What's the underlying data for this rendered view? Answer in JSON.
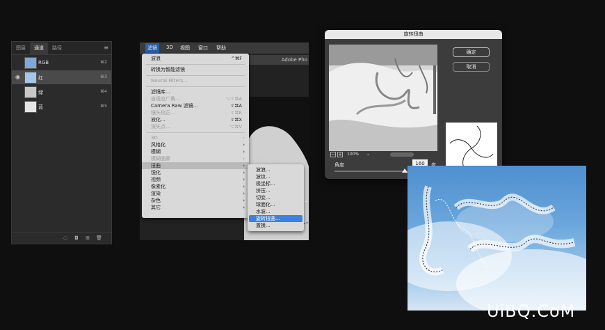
{
  "channels_panel": {
    "tabs": [
      "图层",
      "通道",
      "路径"
    ],
    "active_tab": 1,
    "menu_icon": "panel-menu-icon",
    "rows": [
      {
        "name": "RGB",
        "shortcut": "⌘2",
        "thumb_color": "#7ea8d6",
        "visible": false,
        "selected": false
      },
      {
        "name": "红",
        "shortcut": "⌘3",
        "thumb_color": "#a6c6e6",
        "visible": true,
        "selected": true
      },
      {
        "name": "绿",
        "shortcut": "⌘4",
        "thumb_color": "#c8c8c8",
        "visible": false,
        "selected": false
      },
      {
        "name": "蓝",
        "shortcut": "⌘5",
        "thumb_color": "#e6e6e6",
        "visible": false,
        "selected": false
      }
    ],
    "bottom_icons": [
      "load-selection-icon",
      "save-selection-icon",
      "new-channel-icon",
      "delete-channel-icon"
    ]
  },
  "menubar": {
    "items": [
      "滤镜",
      "3D",
      "视图",
      "窗口",
      "帮助"
    ],
    "active": "滤镜",
    "app_title": "Adobe Pho"
  },
  "filter_menu": {
    "items": [
      {
        "label": "波浪",
        "shortcut": "^⌘F"
      },
      {
        "sep": true
      },
      {
        "label": "转换为智能滤镜"
      },
      {
        "sep": true
      },
      {
        "label": "Neural Filters...",
        "disabled": true
      },
      {
        "sep": true
      },
      {
        "label": "滤镜库..."
      },
      {
        "label": "自适应广角...",
        "shortcut": "⌥⇧⌘A",
        "disabled": true
      },
      {
        "label": "Camera Raw 滤镜...",
        "shortcut": "⇧⌘A"
      },
      {
        "label": "镜头校正...",
        "shortcut": "⇧⌘R",
        "disabled": true
      },
      {
        "label": "液化...",
        "shortcut": "⇧⌘X"
      },
      {
        "label": "消失点...",
        "shortcut": "⌥⌘V",
        "disabled": true
      },
      {
        "sep": true
      },
      {
        "label": "3D",
        "submenu": true,
        "disabled": true
      },
      {
        "label": "风格化",
        "submenu": true
      },
      {
        "label": "模糊",
        "submenu": true
      },
      {
        "label": "模糊画廊",
        "submenu": true,
        "disabled": true
      },
      {
        "label": "扭曲",
        "submenu": true,
        "highlighted": true
      },
      {
        "label": "锐化",
        "submenu": true
      },
      {
        "label": "视频",
        "submenu": true
      },
      {
        "label": "像素化",
        "submenu": true
      },
      {
        "label": "渲染",
        "submenu": true
      },
      {
        "label": "杂色",
        "submenu": true
      },
      {
        "label": "其它",
        "submenu": true
      }
    ]
  },
  "distort_submenu": {
    "items": [
      "波浪...",
      "波纹...",
      "极坐标...",
      "挤压...",
      "切变...",
      "球面化...",
      "水波...",
      "旋转扭曲...",
      "置换..."
    ],
    "selected": "旋转扭曲..."
  },
  "twirl_dialog": {
    "title": "旋转扭曲",
    "ok_label": "确定",
    "cancel_label": "取消",
    "zoom": "100%",
    "angle_label": "角度",
    "angle_value": "160",
    "angle_unit": "度",
    "slider_fraction": 0.72
  },
  "watermark": "UiBQ.CoM"
}
